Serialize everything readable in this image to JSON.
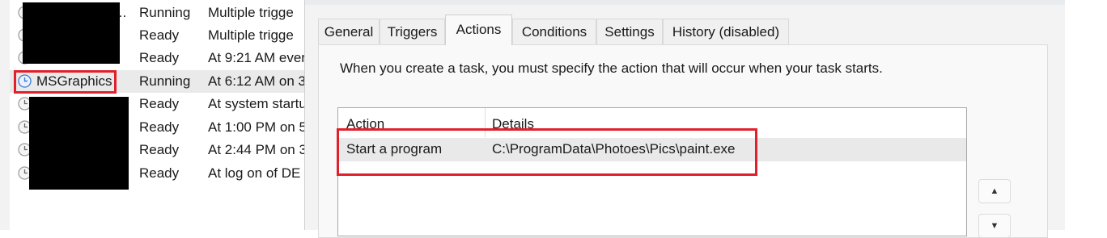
{
  "task_list": {
    "rows": [
      {
        "name": "...",
        "status": "Running",
        "trigger": "Multiple trigge",
        "selected": false
      },
      {
        "name": "",
        "status": "Ready",
        "trigger": "Multiple trigge",
        "selected": false
      },
      {
        "name": "",
        "status": "Ready",
        "trigger": "At 9:21 AM ever",
        "selected": false
      },
      {
        "name": "MSGraphics",
        "status": "Running",
        "trigger": "At 6:12 AM on 3",
        "selected": true
      },
      {
        "name": "",
        "status": "Ready",
        "trigger": "At system startu",
        "selected": false
      },
      {
        "name": "",
        "status": "Ready",
        "trigger": "At 1:00 PM on 5",
        "selected": false
      },
      {
        "name": "",
        "status": "Ready",
        "trigger": "At 2:44 PM on 3",
        "selected": false
      },
      {
        "name": "",
        "status": "Ready",
        "trigger": "At log on of DE",
        "selected": false
      }
    ]
  },
  "dialog": {
    "tabs": [
      "General",
      "Triggers",
      "Actions",
      "Conditions",
      "Settings",
      "History (disabled)"
    ],
    "active_tab": "Actions",
    "description": "When you create a task, you must specify the action that will occur when your task starts.",
    "actions_table": {
      "headers": [
        "Action",
        "Details"
      ],
      "rows": [
        {
          "action": "Start a program",
          "details": "C:\\ProgramData\\Photoes\\Pics\\paint.exe"
        }
      ]
    },
    "move_up_icon": "triangle-up-icon",
    "move_down_icon": "triangle-down-icon"
  },
  "colors": {
    "highlight": "#e0202b",
    "selected_row": "#eaeaea",
    "clock_icon": "#3a78d4"
  }
}
